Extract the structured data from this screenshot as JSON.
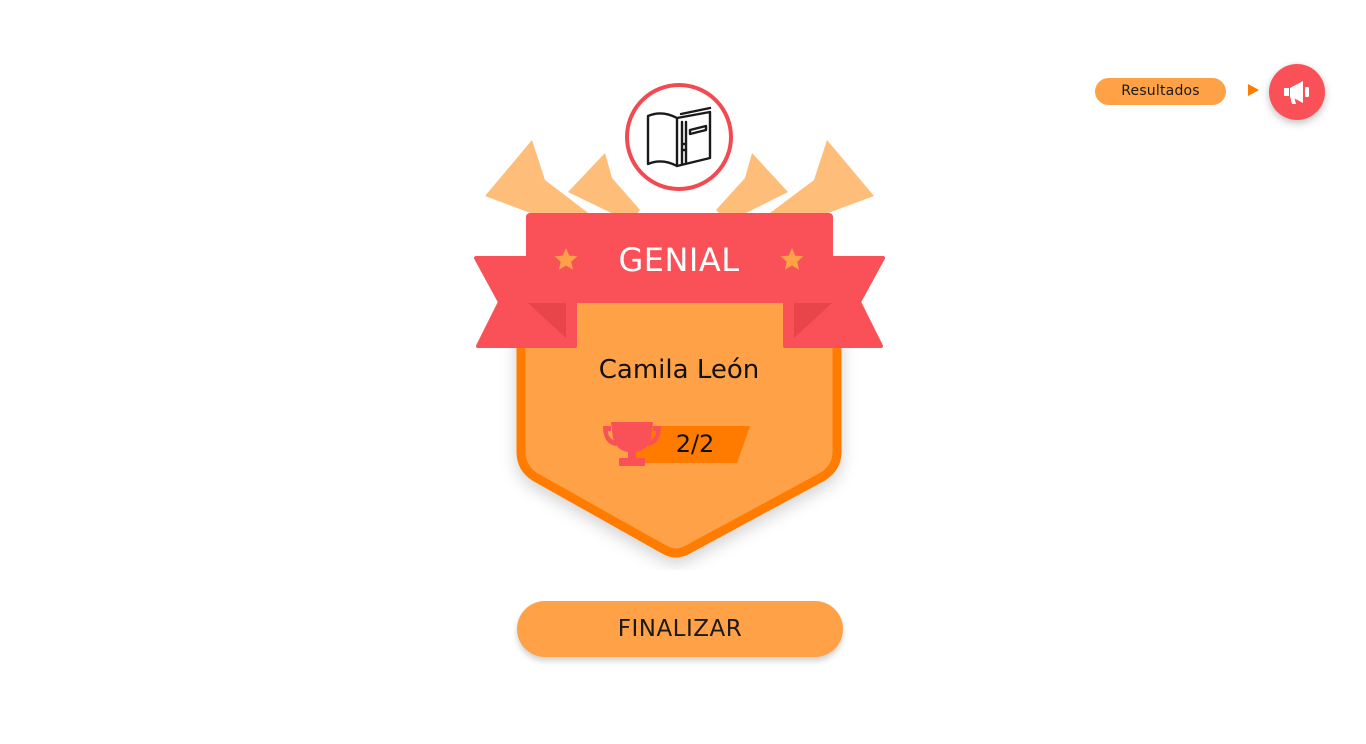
{
  "header": {
    "results_label": "Resultados",
    "megaphone_icon": "megaphone-icon"
  },
  "badge": {
    "subject_icon": "book-icon",
    "title": "GENIAL",
    "player_name": "Camila León",
    "score": "2/2",
    "score_icon": "trophy-icon"
  },
  "actions": {
    "finish_label": "FINALIZAR"
  },
  "colors": {
    "accent_red": "#f95157",
    "orange": "#ffa146",
    "dark_orange": "#ff7b00",
    "light_orange": "#ffbd7a",
    "star": "#ffa146"
  }
}
